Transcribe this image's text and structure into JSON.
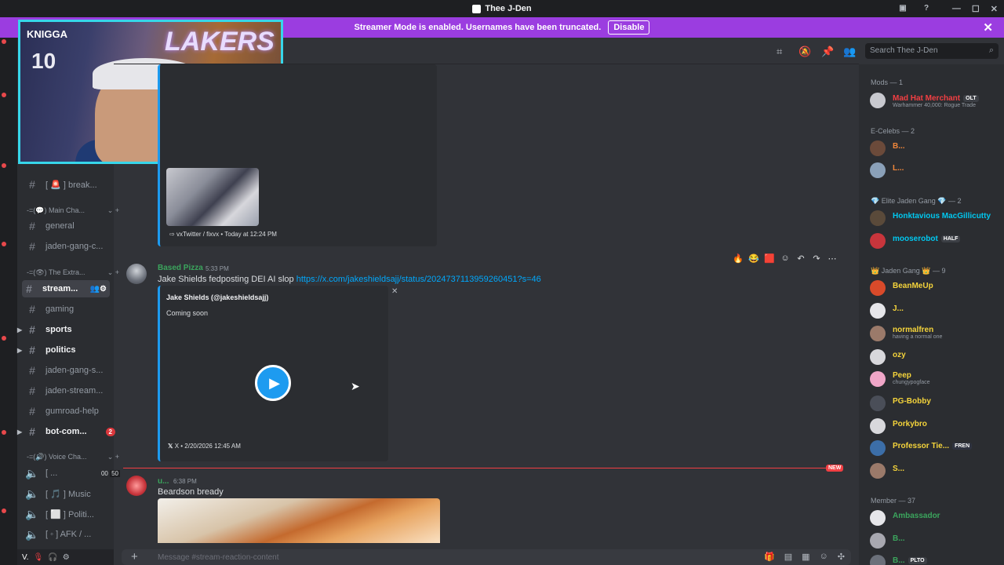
{
  "window": {
    "title": "Thee J-Den"
  },
  "banner": {
    "text": "Streamer Mode is enabled. Usernames have been truncated.",
    "button": "Disable"
  },
  "webcam": {
    "overlay_text": "KNIGGA",
    "jersey_number": "10",
    "logo_text": "LAKERS"
  },
  "sidebar": {
    "channels_top": [
      {
        "label": "[ 🚨 ] break..."
      }
    ],
    "categories": [
      "Main Cha...",
      "The Extra...",
      "Voice Cha..."
    ],
    "main_channels": [
      {
        "label": "general"
      },
      {
        "label": "jaden-gang-c..."
      }
    ],
    "extra_channels": [
      {
        "label": "stream...",
        "active": true
      },
      {
        "label": "gaming"
      },
      {
        "label": "sports",
        "bold": true
      },
      {
        "label": "politics",
        "bold": true
      },
      {
        "label": "jaden-gang-s..."
      },
      {
        "label": "jaden-stream..."
      },
      {
        "label": "gumroad-help"
      },
      {
        "label": "bot-com...",
        "bold": true,
        "badge": "2"
      }
    ],
    "voice_channels": [
      {
        "label": "[ ...",
        "count_a": "00",
        "count_b": "50"
      },
      {
        "label": "[ 🎵 ] Music"
      },
      {
        "label": "[ ⬜ ] Politi..."
      },
      {
        "label": "[ ◦ ] AFK / ..."
      }
    ],
    "user": {
      "name": "V."
    }
  },
  "chat": {
    "embed1": {
      "footer": "vxTwitter / fixvx • Today at 12:24 PM"
    },
    "msg1": {
      "author": "Based Pizza",
      "time": "5:33 PM",
      "text": "Jake Shields fedposting DEI AI slop",
      "link": "https://x.com/jakeshieldsajj/status/2024737113959260451?s=46",
      "embed": {
        "author": "Jake Shields (@jakeshieldsajj)",
        "desc": "Coming soon",
        "footer": "X • 2/20/2026 12:45 AM"
      }
    },
    "new_label": "NEW",
    "msg2": {
      "author": "u...",
      "time": "6:38 PM",
      "text": "Beardson bready"
    },
    "input_placeholder": "Message #stream-reaction-content"
  },
  "search": {
    "placeholder": "Search Thee J-Den"
  },
  "members": {
    "groups": [
      {
        "header": "Mods — 1",
        "members": [
          {
            "name": "Mad Hat Merchant",
            "color": "#f23f43",
            "tag": "OLT",
            "sub": "Warhammer 40,000: Rogue Trade"
          }
        ]
      },
      {
        "header": "E-Celebs — 2",
        "members": [
          {
            "name": "B...",
            "color": "#f0863a"
          },
          {
            "name": "L...",
            "color": "#f0863a"
          }
        ]
      },
      {
        "header": "💎 Elite Jaden Gang 💎 — 2",
        "members": [
          {
            "name": "Honktavious MacGillicutty",
            "color": "#00c8f0"
          },
          {
            "name": "mooserobot",
            "color": "#00c8f0",
            "tag": "HALF"
          }
        ]
      },
      {
        "header": "👑 Jaden Gang 👑 — 9",
        "members": [
          {
            "name": "BeanMeUp",
            "color": "#f5d43b"
          },
          {
            "name": "J...",
            "color": "#f5d43b"
          },
          {
            "name": "normalfren",
            "color": "#f5d43b",
            "sub": "having a normal one"
          },
          {
            "name": "ozy",
            "color": "#f5d43b"
          },
          {
            "name": "Peep",
            "color": "#f5d43b",
            "sub": "chungypogface"
          },
          {
            "name": "PG-Bobby",
            "color": "#f5d43b"
          },
          {
            "name": "Porkybro",
            "color": "#f5d43b"
          },
          {
            "name": "Professor Tie...",
            "color": "#f5d43b",
            "tag": "FREN"
          },
          {
            "name": "S...",
            "color": "#f5d43b"
          }
        ]
      },
      {
        "header": "Member — 37",
        "members": [
          {
            "name": "Ambassador",
            "color": "#3ba55d"
          },
          {
            "name": "B...",
            "color": "#3ba55d"
          },
          {
            "name": "B...",
            "color": "#3ba55d",
            "tag": "PLTO"
          }
        ]
      }
    ]
  },
  "colors": {
    "accent": "#9b3de0",
    "link": "#00a8fc",
    "new": "#f23f43",
    "twitter": "#1d9bf0",
    "webcam_border": "#37d6ea"
  }
}
